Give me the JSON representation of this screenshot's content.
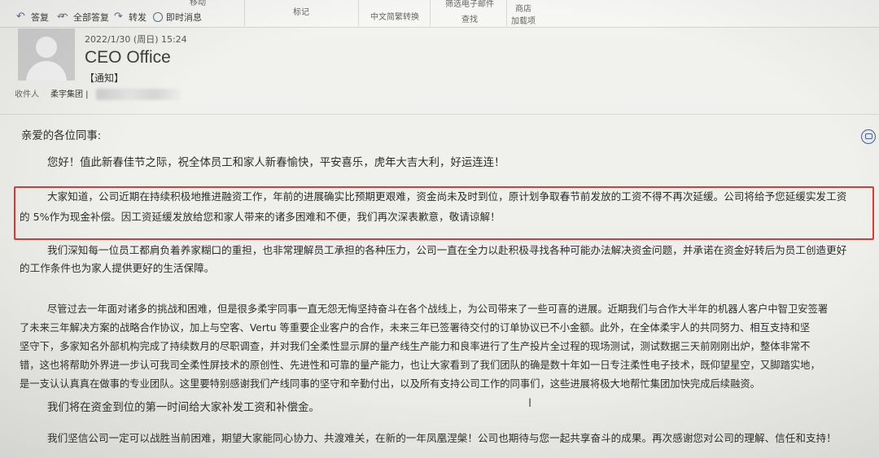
{
  "ribbon": {
    "actions": [
      {
        "label": "答复",
        "icon": "reply-icon"
      },
      {
        "label": "全部答复",
        "icon": "reply-all-icon"
      },
      {
        "label": "转发",
        "icon": "forward-icon"
      },
      {
        "label": "即时消息",
        "icon": "instant-message-icon"
      }
    ],
    "groups": {
      "move": "移动",
      "tags": "标记",
      "chinese_convert": "中文简繁转换",
      "filter_mail": "筛选电子邮件",
      "find": "查找",
      "store": "商店",
      "addins": "加载项"
    }
  },
  "message": {
    "date": "2022/1/30 (周日) 15:24",
    "sender": "CEO Office",
    "subject": "【通知】",
    "to_label": "收件人",
    "to_value": "柔宇集团 |"
  },
  "body": {
    "greeting": "亲爱的各位同事:",
    "p1": "您好！值此新春佳节之际，祝全体员工和家人新春愉快，平安喜乐，虎年大吉大利，好运连连！",
    "p2_line1": "大家知道，公司近期在持续积极地推进融资工作，年前的进展确实比预期更艰难，资金尚未及时到位，原计划争取春节前发放的工资不得不再次延缓。公司将给予您延缓实发工资",
    "p2_line2": "的 5%作为现金补偿。因工资延缓发放给您和家人带来的诸多困难和不便，我们再次深表歉意，敬请谅解！",
    "p3_line1": "我们深知每一位员工都肩负着养家糊口的重担，也非常理解员工承担的各种压力，公司一直在全力以赴积极寻找各种可能办法解决资金问题，并承诺在资金好转后为员工创造更好",
    "p3_line2": "的工作条件也为家人提供更好的生活保障。",
    "p4_line1": "尽管过去一年面对诸多的挑战和困难，但是很多柔宇同事一直无怨无悔坚持奋斗在各个战线上，为公司带来了一些可喜的进展。近期我们与合作大半年的机器人客户中智卫安签署",
    "p4_line2": "了未来三年解决方案的战略合作协议，加上与空客、Vertu 等重要企业客户的合作，未来三年已签署待交付的订单协议已不小金额。此外，在全体柔宇人的共同努力、相互支持和坚",
    "p4_line3": "坚守下，多家知名外部机构完成了持续数月的尽职调查，并对我们全柔性显示屏的量产线生产能力和良率进行了生产投片全过程的现场测试，测试数据三天前刚刚出炉，整体非常不",
    "p4_line4": "错，这也将帮助外界进一步认可我司全柔性屏技术的原创性、先进性和可靠的量产能力，也让大家看到了我们团队的确是数十年如一日专注柔性电子技术，既仰望星空，又脚踏实地，",
    "p4_line5": "是一支认认真真在做事的专业团队。这里要特别感谢我们产线同事的坚守和辛勤付出，以及所有支持公司工作的同事们，这些进展将极大地帮忙集团加快完成后续融资。",
    "p5": "我们将在资金到位的第一时间给大家补发工资和补偿金。",
    "p6": "我们坚信公司一定可以战胜当前困难，期望大家能同心协力、共渡难关，在新的一年凤凰涅槃！公司也期待与您一起共享奋斗的成果。再次感谢您对公司的理解、信任和支持！"
  },
  "colors": {
    "highlight_border": "#e5362e",
    "icon_blue": "#5a6c85"
  }
}
